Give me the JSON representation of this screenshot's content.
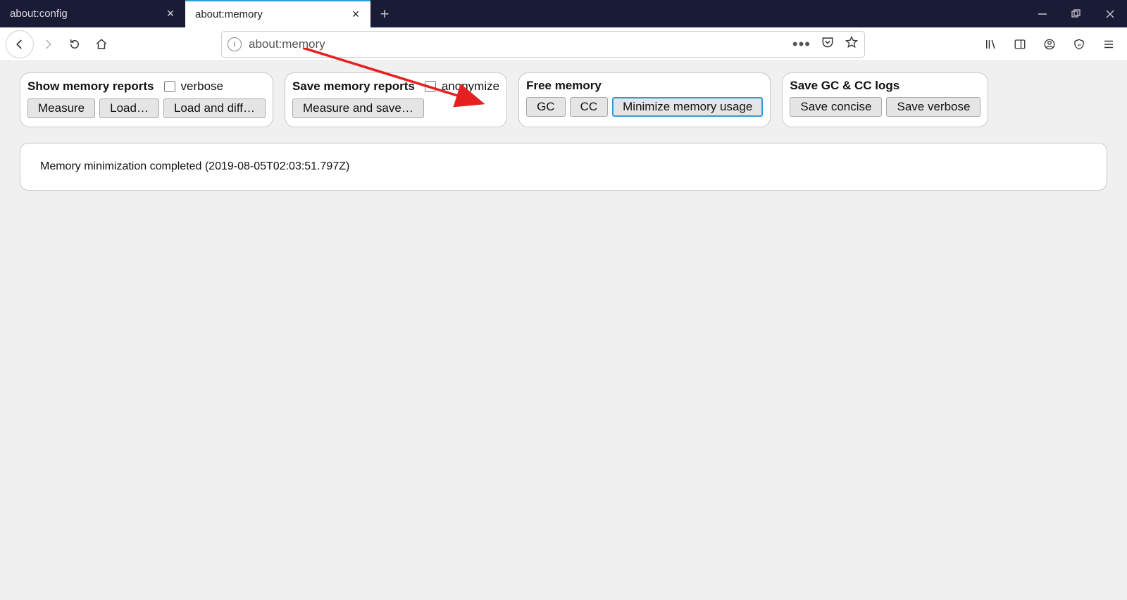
{
  "tabs": [
    {
      "title": "about:config",
      "active": false
    },
    {
      "title": "about:memory",
      "active": true
    }
  ],
  "url": "about:memory",
  "panels": {
    "show": {
      "heading": "Show memory reports",
      "checkbox": "verbose",
      "buttons": [
        "Measure",
        "Load…",
        "Load and diff…"
      ]
    },
    "save": {
      "heading": "Save memory reports",
      "checkbox": "anonymize",
      "buttons": [
        "Measure and save…"
      ]
    },
    "free": {
      "heading": "Free memory",
      "buttons": [
        "GC",
        "CC",
        "Minimize memory usage"
      ]
    },
    "logs": {
      "heading": "Save GC & CC logs",
      "buttons": [
        "Save concise",
        "Save verbose"
      ]
    }
  },
  "output": "Memory minimization completed (2019-08-05T02:03:51.797Z)"
}
